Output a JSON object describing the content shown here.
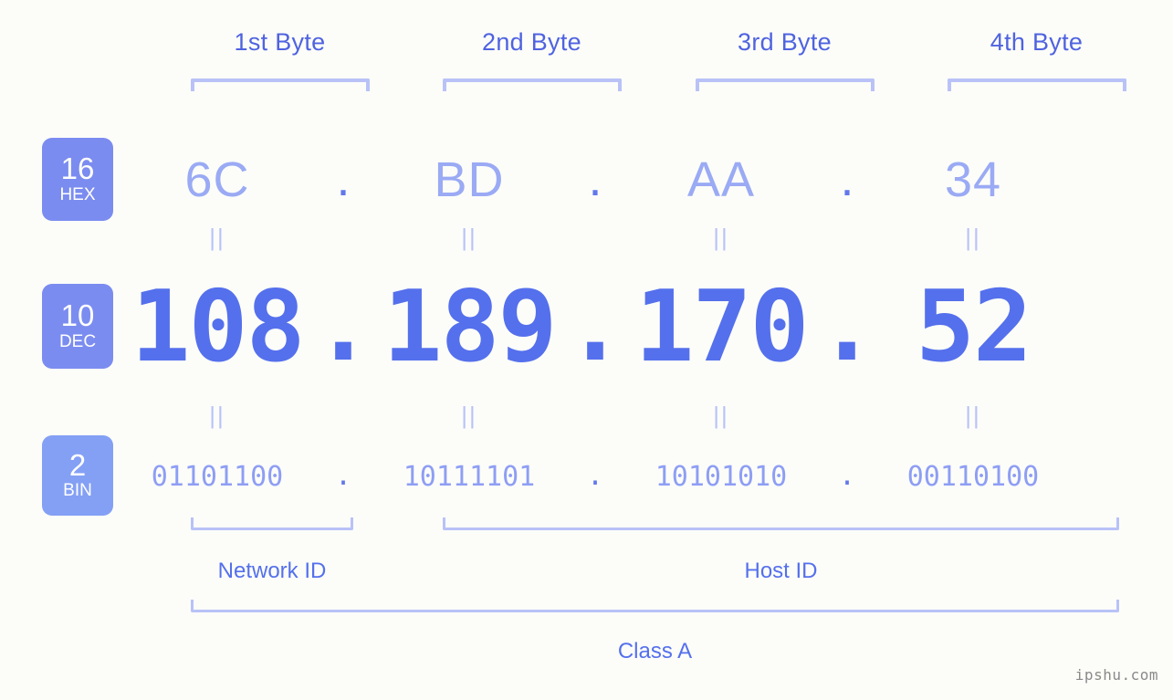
{
  "background": "#fcfdf9",
  "accent": "#5570ec",
  "accent_light": "#9aaaf4",
  "bracket_color": "#b9c2f7",
  "byte_headers": [
    {
      "label": "1st Byte"
    },
    {
      "label": "2nd Byte"
    },
    {
      "label": "3rd Byte"
    },
    {
      "label": "4th Byte"
    }
  ],
  "bases": [
    {
      "number": "16",
      "abbr": "HEX",
      "color": "#7b8cf0"
    },
    {
      "number": "10",
      "abbr": "DEC",
      "color": "#7b8cf0"
    },
    {
      "number": "2",
      "abbr": "BIN",
      "color": "#84a0f5"
    }
  ],
  "separator": {
    "dot": ".",
    "equals": "||"
  },
  "rows": {
    "hex": {
      "base_number": "16",
      "base_abbr": "HEX",
      "values": [
        "6C",
        "BD",
        "AA",
        "34"
      ]
    },
    "dec": {
      "base_number": "10",
      "base_abbr": "DEC",
      "values": [
        "108",
        "189",
        "170",
        "52"
      ]
    },
    "bin": {
      "base_number": "2",
      "base_abbr": "BIN",
      "values": [
        "01101100",
        "10111101",
        "10101010",
        "00110100"
      ]
    }
  },
  "sections": {
    "network_id": "Network ID",
    "host_id": "Host ID",
    "class": "Class A"
  },
  "watermark": "ipshu.com"
}
